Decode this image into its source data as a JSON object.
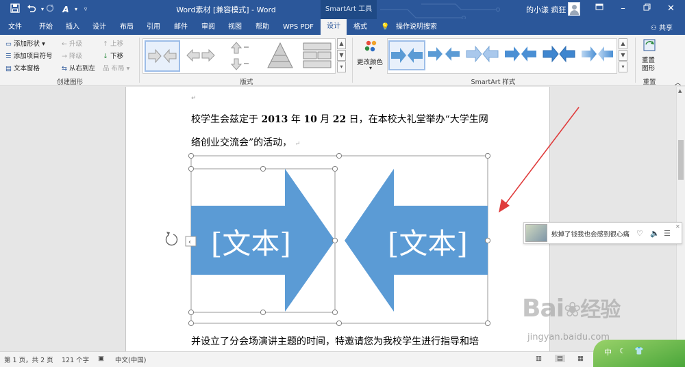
{
  "window": {
    "title": "Word素材 [兼容模式] - Word",
    "context_tool": "SmartArt 工具",
    "user": "的小漾 疯狂",
    "colors": {
      "title_bar": "#2b579a",
      "ribbon": "#f3f3f3",
      "smartart_fill": "#5b9bd5",
      "annotation_arrow": "#e03c3c"
    }
  },
  "quick_access": {
    "save_icon": "save-icon",
    "undo_icon": "undo-icon",
    "redo_icon": "redo-icon",
    "format_icon": "font-format-icon",
    "customize_icon": "customize-icon"
  },
  "tabs": [
    "文件",
    "开始",
    "插入",
    "设计",
    "布局",
    "引用",
    "邮件",
    "审阅",
    "视图",
    "帮助",
    "WPS PDF",
    "设计",
    "格式"
  ],
  "active_tab_index": 11,
  "tell_me": "操作说明搜索",
  "share": "共享",
  "ribbon": {
    "create_group": {
      "add_shape": "添加形状",
      "add_bullet": "添加项目符号",
      "text_pane": "文本窗格",
      "promote": "升级",
      "demote": "降级",
      "right_to_left": "从右到左",
      "move_up": "上移",
      "move_down": "下移",
      "layout": "布局",
      "label": "创建图形"
    },
    "layouts_group": {
      "label": "版式"
    },
    "styles_group": {
      "change_colors": "更改颜色",
      "label": "SmartArt 样式"
    },
    "reset_group": {
      "reset_graphic": "重置图形",
      "label": "重置"
    }
  },
  "document": {
    "para1_a": "校学生会兹定于 ",
    "para1_year": "2013",
    "para1_b": " 年 ",
    "para1_month": "10",
    "para1_c": " 月 ",
    "para1_day": "22",
    "para1_d": " 日，在本校大礼堂举办“大学生网",
    "para2": "络创业交流会”的活动，",
    "para3": "并设立了分会场演讲主题的时间，特邀请您为我校学生进行指导和培",
    "smartart_left_text": "[文本]",
    "smartart_right_text": "[文本]"
  },
  "music_widget": {
    "text": "欸掉了钱我也会感到很心痛"
  },
  "status": {
    "page": "第 1 页，共 2 页",
    "words": "121 个字",
    "language": "中文(中国)"
  },
  "watermark": {
    "brand": "Bai",
    "cn": "经验",
    "url": "jingyan.baidu.com"
  },
  "ime": {
    "mode": "中"
  }
}
